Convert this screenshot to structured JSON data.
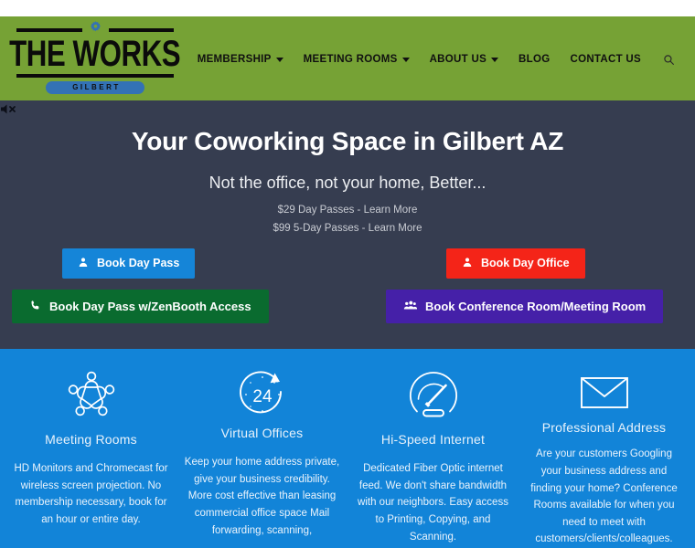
{
  "header": {
    "logo": {
      "word": "THE WORKS",
      "badge": "GILBERT",
      "gear_icon": "gear-icon"
    },
    "nav": [
      {
        "label": "MEMBERSHIP",
        "has_dropdown": true
      },
      {
        "label": "MEETING ROOMS",
        "has_dropdown": true
      },
      {
        "label": "ABOUT US",
        "has_dropdown": true
      },
      {
        "label": "BLOG",
        "has_dropdown": false
      },
      {
        "label": "CONTACT US",
        "has_dropdown": false
      }
    ],
    "search_icon": "search-icon",
    "bg_color": "#76a235"
  },
  "hero": {
    "mute_icon": "speaker-mute-icon",
    "title": "Your Coworking Space in Gilbert AZ",
    "subtitle": "Not the office, not your home, Better...",
    "links": [
      "$29 Day Passes - Learn More",
      "$99 5-Day Passes - Learn More"
    ],
    "bg_color": "#363d50",
    "buttons": [
      {
        "label": "Book Day Pass",
        "color": "#1585d8",
        "icon": "person-icon"
      },
      {
        "label": "Book Day Office",
        "color": "#f42418",
        "icon": "person-icon"
      },
      {
        "label": "Book Day Pass w/ZenBooth Access",
        "color": "#0a6b2f",
        "icon": "phone-icon"
      },
      {
        "label": "Book Conference Room/Meeting Room",
        "color": "#4520a8",
        "icon": "group-icon"
      }
    ]
  },
  "features": {
    "bg_color": "#1284d8",
    "items": [
      {
        "icon": "people-circle-icon",
        "title": "Meeting Rooms",
        "body": "HD Monitors and Chromecast for wireless screen projection. No membership necessary, book for an hour or entire day."
      },
      {
        "icon": "clock-24-icon",
        "title": "Virtual Offices",
        "body": "Keep your home address private, give your business credibility. More cost effective than leasing commercial office space Mail forwarding, scanning,"
      },
      {
        "icon": "speedometer-icon",
        "title": "Hi-Speed Internet",
        "body": "Dedicated Fiber Optic internet feed. We don't share bandwidth with our neighbors. Easy access to Printing, Copying, and Scanning."
      },
      {
        "icon": "envelope-icon",
        "title": "Professional Address",
        "body": "Are your customers Googling your business address and finding your home? Conference Rooms available for when you need to meet with customers/clients/colleagues."
      }
    ]
  }
}
